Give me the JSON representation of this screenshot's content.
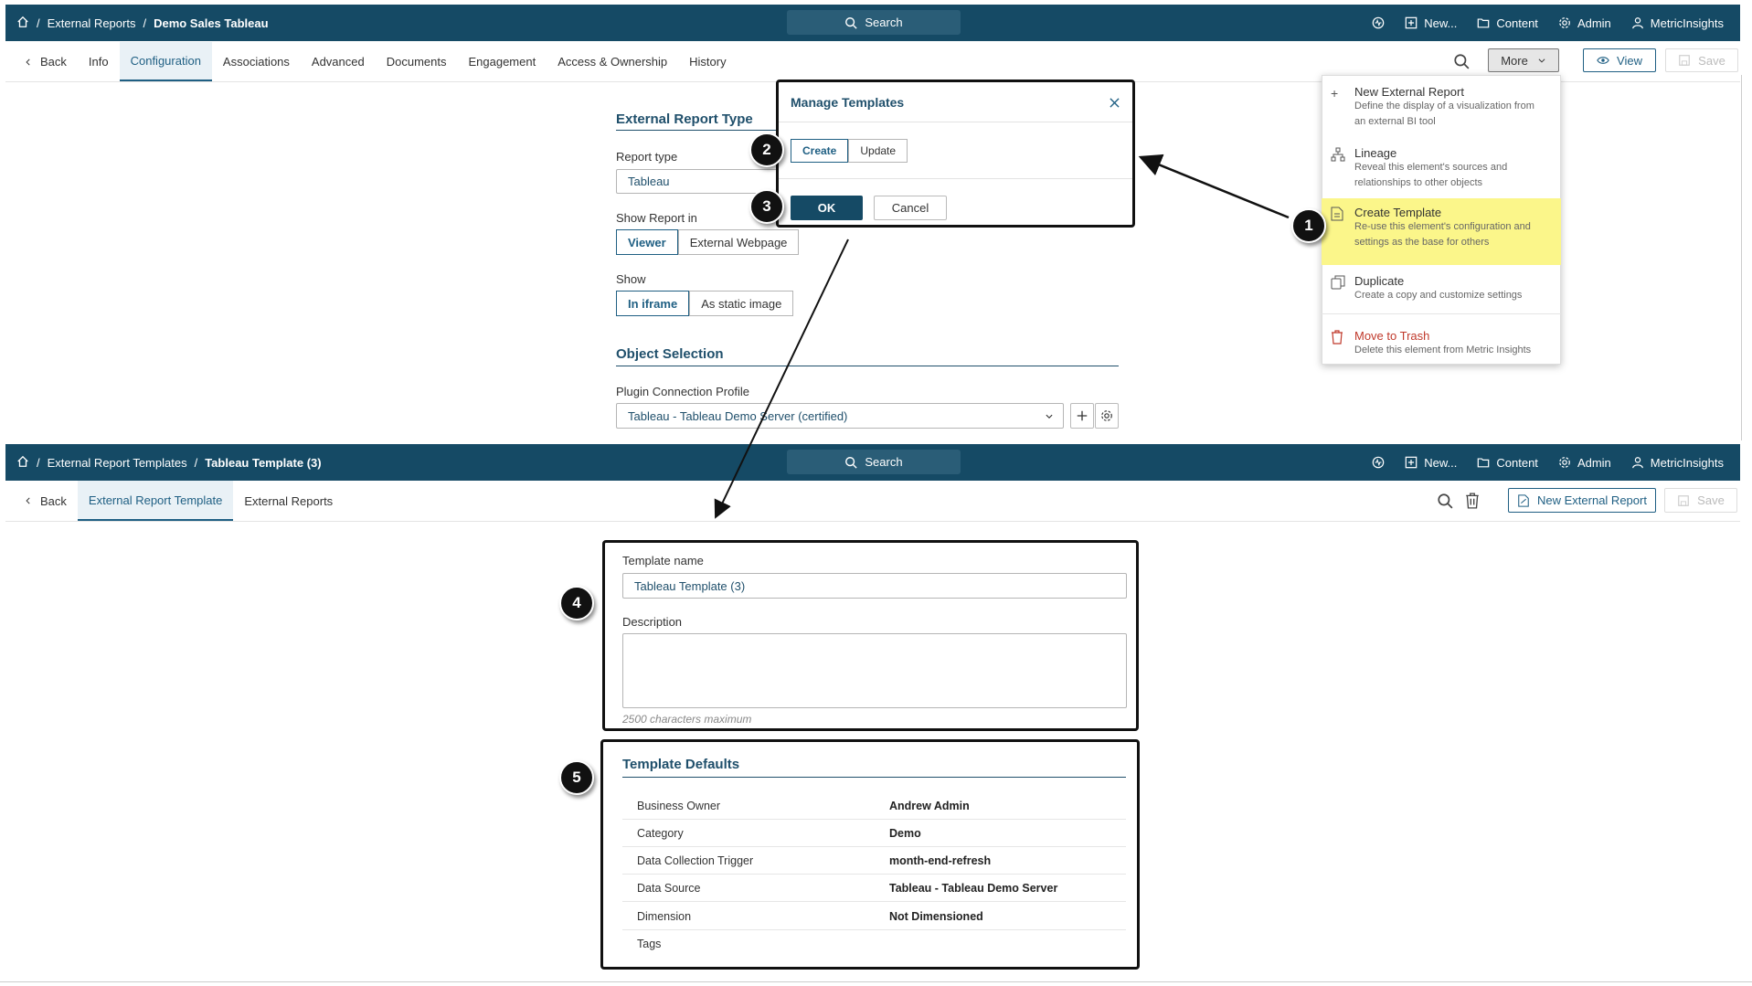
{
  "top_header": {
    "breadcrumb_1": "External Reports",
    "breadcrumb_2": "Demo Sales Tableau",
    "search_label": "Search",
    "new_label": "New...",
    "content_label": "Content",
    "admin_label": "Admin",
    "user_label": "MetricInsights"
  },
  "top_tabs": {
    "back": "Back",
    "items": [
      "Info",
      "Configuration",
      "Associations",
      "Advanced",
      "Documents",
      "Engagement",
      "Access & Ownership",
      "History"
    ],
    "more_label": "More",
    "view_label": "View",
    "save_label": "Save"
  },
  "config": {
    "external_report_type_title": "External Report Type",
    "report_type_label": "Report type",
    "report_type_value": "Tableau",
    "show_report_in_label": "Show Report in",
    "show_report_in_options": [
      "Viewer",
      "External Webpage"
    ],
    "show_label": "Show",
    "show_options": [
      "In iframe",
      "As static image"
    ],
    "object_selection_title": "Object Selection",
    "plugin_profile_label": "Plugin Connection Profile",
    "plugin_profile_value": "Tableau - Tableau Demo Server (certified)"
  },
  "manage_templates": {
    "title": "Manage Templates",
    "create_label": "Create",
    "update_label": "Update",
    "ok_label": "OK",
    "cancel_label": "Cancel"
  },
  "more_menu": {
    "items": [
      {
        "title": "New External Report",
        "desc1": "Define the display of a visualization from",
        "desc2": "an external BI tool",
        "icon": "plus-icon"
      },
      {
        "title": "Lineage",
        "desc1": "Reveal this element's sources and",
        "desc2": "relationships to other objects",
        "icon": "lineage-icon"
      },
      {
        "title": "Create Template",
        "desc1": "Re-use this element's configuration and",
        "desc2": "settings as the base for others",
        "icon": "template-icon"
      },
      {
        "title": "Duplicate",
        "desc1": "Create a copy and customize settings",
        "desc2": "",
        "icon": "duplicate-icon"
      },
      {
        "title": "Move to Trash",
        "desc1": "Delete this element from Metric Insights",
        "desc2": "",
        "icon": "trash-icon"
      }
    ]
  },
  "callouts": [
    "1",
    "2",
    "3",
    "4",
    "5"
  ],
  "bottom_header": {
    "breadcrumb_1": "External Report Templates",
    "breadcrumb_2": "Tableau Template (3)",
    "search_label": "Search",
    "new_label": "New...",
    "content_label": "Content",
    "admin_label": "Admin",
    "user_label": "MetricInsights"
  },
  "bottom_tabs": {
    "back": "Back",
    "items": [
      "External Report Template",
      "External Reports"
    ],
    "new_external_report_label": "New External Report",
    "save_label": "Save"
  },
  "template_form": {
    "name_label": "Template name",
    "name_value": "Tableau Template (3)",
    "description_label": "Description",
    "description_hint": "2500 characters maximum"
  },
  "template_defaults": {
    "title": "Template Defaults",
    "rows": [
      {
        "key": "Business Owner",
        "value": "Andrew Admin"
      },
      {
        "key": "Category",
        "value": "Demo"
      },
      {
        "key": "Data Collection Trigger",
        "value": "month-end-refresh"
      },
      {
        "key": "Data Source",
        "value": "Tableau - Tableau Demo Server"
      },
      {
        "key": "Dimension",
        "value": "Not Dimensioned"
      },
      {
        "key": "Tags",
        "value": ""
      }
    ]
  },
  "colors": {
    "header_bg": "#154a65",
    "accent": "#1f5f83",
    "highlight": "#fbf68a",
    "danger": "#c0392b"
  }
}
